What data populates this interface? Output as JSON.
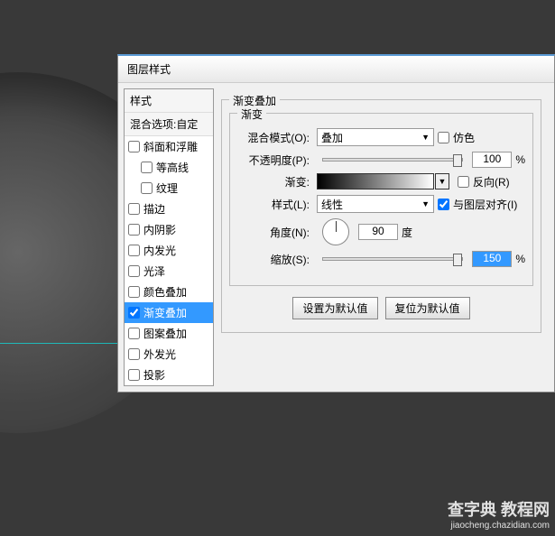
{
  "dialog_title": "图层样式",
  "styles_header": "样式",
  "blend_options": "混合选项:自定",
  "style_items": [
    {
      "label": "斜面和浮雕",
      "checked": false,
      "sel": false
    },
    {
      "label": "等高线",
      "checked": false,
      "sel": false,
      "indent": true
    },
    {
      "label": "纹理",
      "checked": false,
      "sel": false,
      "indent": true
    },
    {
      "label": "描边",
      "checked": false,
      "sel": false
    },
    {
      "label": "内阴影",
      "checked": false,
      "sel": false
    },
    {
      "label": "内发光",
      "checked": false,
      "sel": false
    },
    {
      "label": "光泽",
      "checked": false,
      "sel": false
    },
    {
      "label": "颜色叠加",
      "checked": false,
      "sel": false
    },
    {
      "label": "渐变叠加",
      "checked": true,
      "sel": true
    },
    {
      "label": "图案叠加",
      "checked": false,
      "sel": false
    },
    {
      "label": "外发光",
      "checked": false,
      "sel": false
    },
    {
      "label": "投影",
      "checked": false,
      "sel": false
    }
  ],
  "group_outer": "渐变叠加",
  "group_inner": "渐变",
  "labels": {
    "blend_mode": "混合模式(O):",
    "opacity": "不透明度(P):",
    "gradient": "渐变:",
    "style": "样式(L):",
    "angle": "角度(N):",
    "scale": "缩放(S):"
  },
  "values": {
    "blend_mode": "叠加",
    "dither": "仿色",
    "opacity": "100",
    "percent": "%",
    "reverse": "反向(R)",
    "style": "线性",
    "align": "与图层对齐(I)",
    "angle": "90",
    "degree": "度",
    "scale": "150"
  },
  "checks": {
    "dither": false,
    "reverse": false,
    "align": true
  },
  "buttons": {
    "default": "设置为默认值",
    "reset": "复位为默认值"
  },
  "watermark": {
    "main": "查字典 教程网",
    "sub": "jiaocheng.chazidian.com"
  }
}
